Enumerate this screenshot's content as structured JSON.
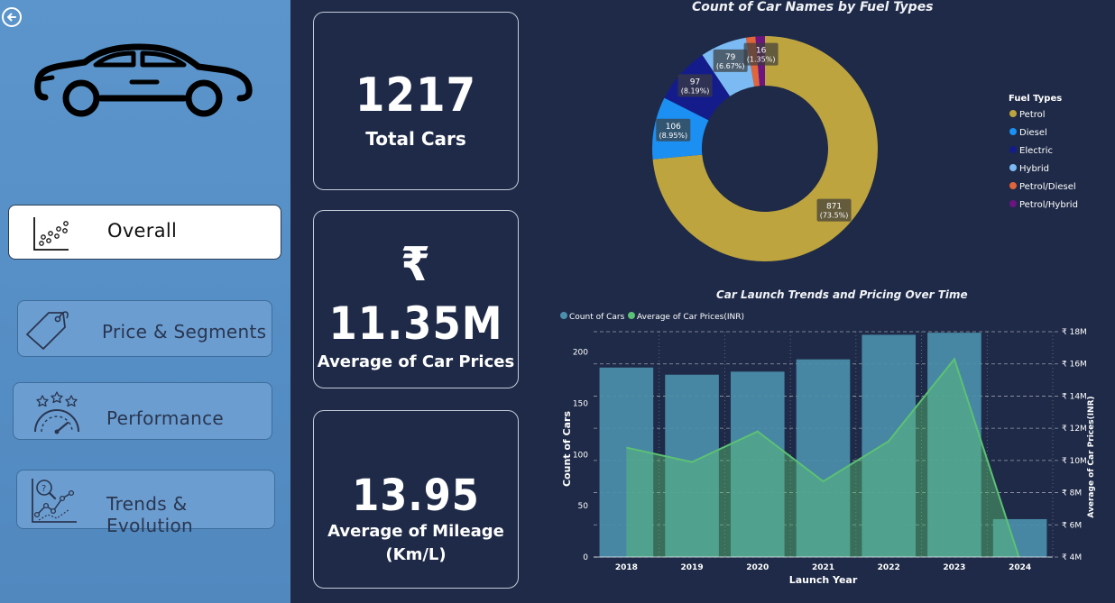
{
  "sidebar": {
    "nav": [
      {
        "label": "Overall",
        "active": true
      },
      {
        "label": "Price & Segments",
        "active": false
      },
      {
        "label": "Performance",
        "active": false
      },
      {
        "label": "Trends & Evolution",
        "active": false
      }
    ]
  },
  "kpis": {
    "total_cars": {
      "value": "1217",
      "label": "Total Cars"
    },
    "avg_price": {
      "symbol": "₹",
      "value": "11.35M",
      "label": "Average of Car Prices"
    },
    "avg_mileage": {
      "value": "13.95",
      "label_line1": "Average of Mileage",
      "label_line2": "(Km/L)"
    }
  },
  "colors": {
    "background": "#1e2a47",
    "sidebar": "#5b95cb",
    "petrol": "#bea43f",
    "diesel": "#1b8ff2",
    "electric": "#141c8c",
    "hybrid": "#7bbaf2",
    "petrol_diesel": "#e0653a",
    "petrol_hybrid": "#6b1580",
    "bar": "#4b8fab",
    "line": "#5cc174"
  },
  "chart_data": [
    {
      "type": "pie",
      "title": "Count of Car Names by Fuel Types",
      "legend_title": "Fuel Types",
      "legend_position": "right",
      "donut": true,
      "slices": [
        {
          "name": "Petrol",
          "value": 871,
          "label": "871",
          "pct": "(73.5%)",
          "color": "#bea43f"
        },
        {
          "name": "Diesel",
          "value": 106,
          "label": "106",
          "pct": "(8.95%)",
          "color": "#1b8ff2"
        },
        {
          "name": "Electric",
          "value": 97,
          "label": "97",
          "pct": "(8.19%)",
          "color": "#141c8c"
        },
        {
          "name": "Hybrid",
          "value": 79,
          "label": "79",
          "pct": "(6.67%)",
          "color": "#7bbaf2"
        },
        {
          "name": "Petrol/Diesel",
          "value": 16,
          "label": "",
          "pct": "",
          "color": "#e0653a"
        },
        {
          "name": "Petrol/Hybrid",
          "value": 16,
          "label": "16",
          "pct": "(1.35%)",
          "color": "#6b1580"
        }
      ]
    },
    {
      "type": "bar",
      "title": "Car Launch Trends and Pricing Over Time",
      "xlabel": "Launch Year",
      "ylabel": "Count of Cars",
      "y2label": "Average of Car Prices(INR)",
      "legend_position": "top-left",
      "categories": [
        "2018",
        "2019",
        "2020",
        "2021",
        "2022",
        "2023",
        "2024"
      ],
      "ylim": [
        0,
        220
      ],
      "yticks": [
        "0",
        "50",
        "100",
        "150",
        "200"
      ],
      "y2lim": [
        4,
        18
      ],
      "y2ticks": [
        "₹ 4M",
        "₹ 6M",
        "₹ 8M",
        "₹ 10M",
        "₹ 12M",
        "₹ 14M",
        "₹ 16M",
        "₹ 18M"
      ],
      "series": [
        {
          "name": "Count of Cars",
          "kind": "bar",
          "values": [
            185,
            178,
            181,
            193,
            217,
            219,
            37
          ]
        },
        {
          "name": "Average of Car Prices(INR)",
          "kind": "line",
          "axis": "right",
          "values": [
            10.8,
            9.9,
            11.8,
            8.7,
            11.2,
            16.3,
            3.8
          ]
        }
      ]
    }
  ]
}
